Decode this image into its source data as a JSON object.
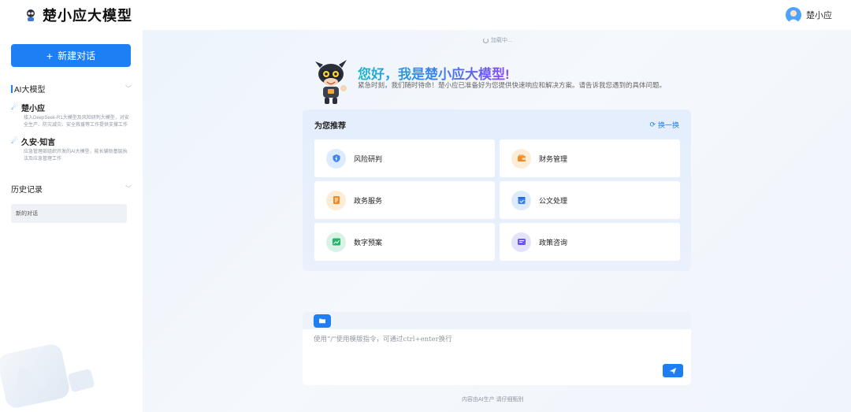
{
  "header": {
    "app_name": "楚小应大模型",
    "user_name": "楚小应"
  },
  "sidebar": {
    "new_chat_label": "新建对话",
    "models_section": "AI大模型",
    "models": [
      {
        "name": "楚小应",
        "desc": "接入DeepSeek-R1大模型及风险研判大模型，对安全生产、防灾减灾、安全救援等工作提供支撑工作"
      },
      {
        "name": "久安·知言",
        "desc": "应急管理部组织开发的AI大模型，能长辅助基层执法及应急管理工作"
      }
    ],
    "history_section": "历史记录",
    "history_items": [
      "新的对话"
    ]
  },
  "main": {
    "loading_text": "加载中...",
    "greeting": "您好，我是楚小应大模型!",
    "intro": "紧急时刻，我们随时待命！楚小应已准备好为您提供快速响应和解决方案。请告诉我您遇到的具体问题。",
    "recommend_title": "为您推荐",
    "swap_label": "换一换",
    "cards": [
      {
        "label": "风险研判"
      },
      {
        "label": "财务管理"
      },
      {
        "label": "政务服务"
      },
      {
        "label": "公文处理"
      },
      {
        "label": "数字预案"
      },
      {
        "label": "政策咨询"
      }
    ],
    "input_placeholder": "使用“/”使用模版指令，可通过ctrl+enter换行",
    "footer_note": "内容由AI生产 请仔细甄别"
  },
  "colors": {
    "accent": "#1e7ff5",
    "card_icon_bg": [
      "#dcebfd",
      "#fdecd6",
      "#fdecd6",
      "#dcebfd",
      "#d8f3e6",
      "#e3e4fb"
    ]
  }
}
